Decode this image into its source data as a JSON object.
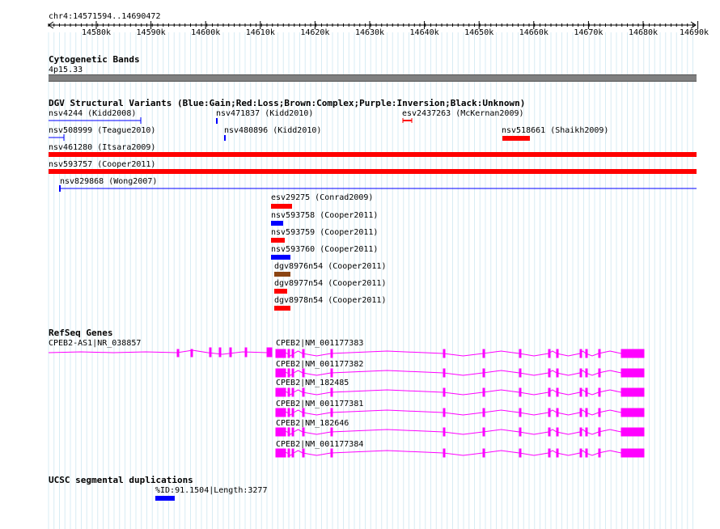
{
  "ruler": {
    "coords": "chr4:14571594..14690472",
    "ticks": [
      "14580k",
      "14590k",
      "14600k",
      "14610k",
      "14620k",
      "14630k",
      "14640k",
      "14650k",
      "14660k",
      "14670k",
      "14680k",
      "14690k"
    ]
  },
  "cyto": {
    "title": "Cytogenetic Bands",
    "band": "4p15.33"
  },
  "dgv": {
    "title": "DGV Structural Variants (Blue:Gain;Red:Loss;Brown:Complex;Purple:Inversion;Black:Unknown)",
    "items": [
      {
        "label": "nsv4244 (Kidd2008)",
        "color": "#0000ff"
      },
      {
        "label": "nsv471837 (Kidd2010)",
        "color": "#0000ff"
      },
      {
        "label": "esv2437263 (McKernan2009)",
        "color": "#ff0000"
      },
      {
        "label": "nsv508999 (Teague2010)",
        "color": "#0000ff"
      },
      {
        "label": "nsv480896 (Kidd2010)",
        "color": "#0000ff"
      },
      {
        "label": "nsv518661 (Shaikh2009)",
        "color": "#ff0000"
      },
      {
        "label": "nsv461280 (Itsara2009)",
        "color": "#ff0000"
      },
      {
        "label": "nsv593757 (Cooper2011)",
        "color": "#ff0000"
      },
      {
        "label": "nsv829868 (Wong2007)",
        "color": "#0000ff"
      },
      {
        "label": "esv29275 (Conrad2009)",
        "color": "#ff0000"
      },
      {
        "label": "nsv593758 (Cooper2011)",
        "color": "#0000ff"
      },
      {
        "label": "nsv593759 (Cooper2011)",
        "color": "#ff0000"
      },
      {
        "label": "nsv593760 (Cooper2011)",
        "color": "#0000ff"
      },
      {
        "label": "dgv8976n54 (Cooper2011)",
        "color": "#8b4513"
      },
      {
        "label": "dgv8977n54 (Cooper2011)",
        "color": "#ff0000"
      },
      {
        "label": "dgv8978n54 (Cooper2011)",
        "color": "#ff0000"
      }
    ]
  },
  "refseq": {
    "title": "RefSeq Genes",
    "color": "#ff00ff",
    "as_label": "CPEB2-AS1|NR_038857",
    "transcripts": [
      {
        "label": "CPEB2|NM_001177383"
      },
      {
        "label": "CPEB2|NM_001177382"
      },
      {
        "label": "CPEB2|NM_182485"
      },
      {
        "label": "CPEB2|NM_001177381"
      },
      {
        "label": "CPEB2|NM_182646"
      },
      {
        "label": "CPEB2|NM_001177384"
      }
    ]
  },
  "segdup": {
    "title": "UCSC segmental duplications",
    "label": "%ID:91.1504|Length:3277",
    "color": "#0000ff"
  }
}
